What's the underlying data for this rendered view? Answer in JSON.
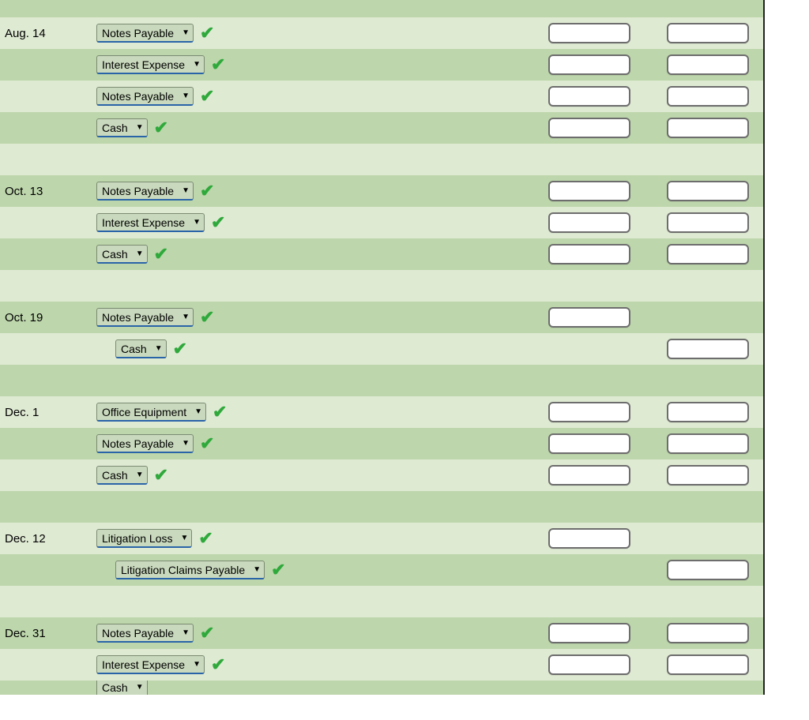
{
  "colors": {
    "row_a": "#dfead3",
    "row_b": "#bdd6ab",
    "check": "#2fa93b",
    "underline": "#2a64a8"
  },
  "rows": [
    {
      "alt": "b",
      "date": "",
      "account": "",
      "indent": 0,
      "check": false,
      "debit": false,
      "credit": false,
      "top_spacer": true
    },
    {
      "alt": "a",
      "date": "Aug. 14",
      "account": "Notes Payable",
      "indent": 0,
      "check": true,
      "debit": true,
      "credit": true
    },
    {
      "alt": "b",
      "date": "",
      "account": "Interest Expense",
      "indent": 0,
      "check": true,
      "debit": true,
      "credit": true
    },
    {
      "alt": "a",
      "date": "",
      "account": "Notes Payable",
      "indent": 0,
      "check": true,
      "debit": true,
      "credit": true
    },
    {
      "alt": "b",
      "date": "",
      "account": "Cash",
      "indent": 0,
      "check": true,
      "debit": true,
      "credit": true
    },
    {
      "alt": "a",
      "date": "",
      "account": "",
      "indent": 0,
      "check": false,
      "debit": false,
      "credit": false
    },
    {
      "alt": "b",
      "date": "Oct. 13",
      "account": "Notes Payable",
      "indent": 0,
      "check": true,
      "debit": true,
      "credit": true
    },
    {
      "alt": "a",
      "date": "",
      "account": "Interest Expense",
      "indent": 0,
      "check": true,
      "debit": true,
      "credit": true
    },
    {
      "alt": "b",
      "date": "",
      "account": "Cash",
      "indent": 0,
      "check": true,
      "debit": true,
      "credit": true
    },
    {
      "alt": "a",
      "date": "",
      "account": "",
      "indent": 0,
      "check": false,
      "debit": false,
      "credit": false
    },
    {
      "alt": "b",
      "date": "Oct. 19",
      "account": "Notes Payable",
      "indent": 0,
      "check": true,
      "debit": true,
      "credit": false
    },
    {
      "alt": "a",
      "date": "",
      "account": "Cash",
      "indent": 24,
      "check": true,
      "debit": false,
      "credit": true
    },
    {
      "alt": "b",
      "date": "",
      "account": "",
      "indent": 0,
      "check": false,
      "debit": false,
      "credit": false
    },
    {
      "alt": "a",
      "date": "Dec. 1",
      "account": "Office Equipment",
      "indent": 0,
      "check": true,
      "debit": true,
      "credit": true
    },
    {
      "alt": "b",
      "date": "",
      "account": "Notes Payable",
      "indent": 0,
      "check": true,
      "debit": true,
      "credit": true
    },
    {
      "alt": "a",
      "date": "",
      "account": "Cash",
      "indent": 0,
      "check": true,
      "debit": true,
      "credit": true
    },
    {
      "alt": "b",
      "date": "",
      "account": "",
      "indent": 0,
      "check": false,
      "debit": false,
      "credit": false
    },
    {
      "alt": "a",
      "date": "Dec. 12",
      "account": "Litigation Loss",
      "indent": 0,
      "check": true,
      "debit": true,
      "credit": false
    },
    {
      "alt": "b",
      "date": "",
      "account": "Litigation Claims Payable",
      "indent": 24,
      "check": true,
      "debit": false,
      "credit": true
    },
    {
      "alt": "a",
      "date": "",
      "account": "",
      "indent": 0,
      "check": false,
      "debit": false,
      "credit": false
    },
    {
      "alt": "b",
      "date": "Dec. 31",
      "account": "Notes Payable",
      "indent": 0,
      "check": true,
      "debit": true,
      "credit": true
    },
    {
      "alt": "a",
      "date": "",
      "account": "Interest Expense",
      "indent": 0,
      "check": true,
      "debit": true,
      "credit": true
    },
    {
      "alt": "b",
      "date": "",
      "account": "Cash",
      "indent": 0,
      "check": false,
      "debit": false,
      "credit": false,
      "partial": true
    }
  ]
}
